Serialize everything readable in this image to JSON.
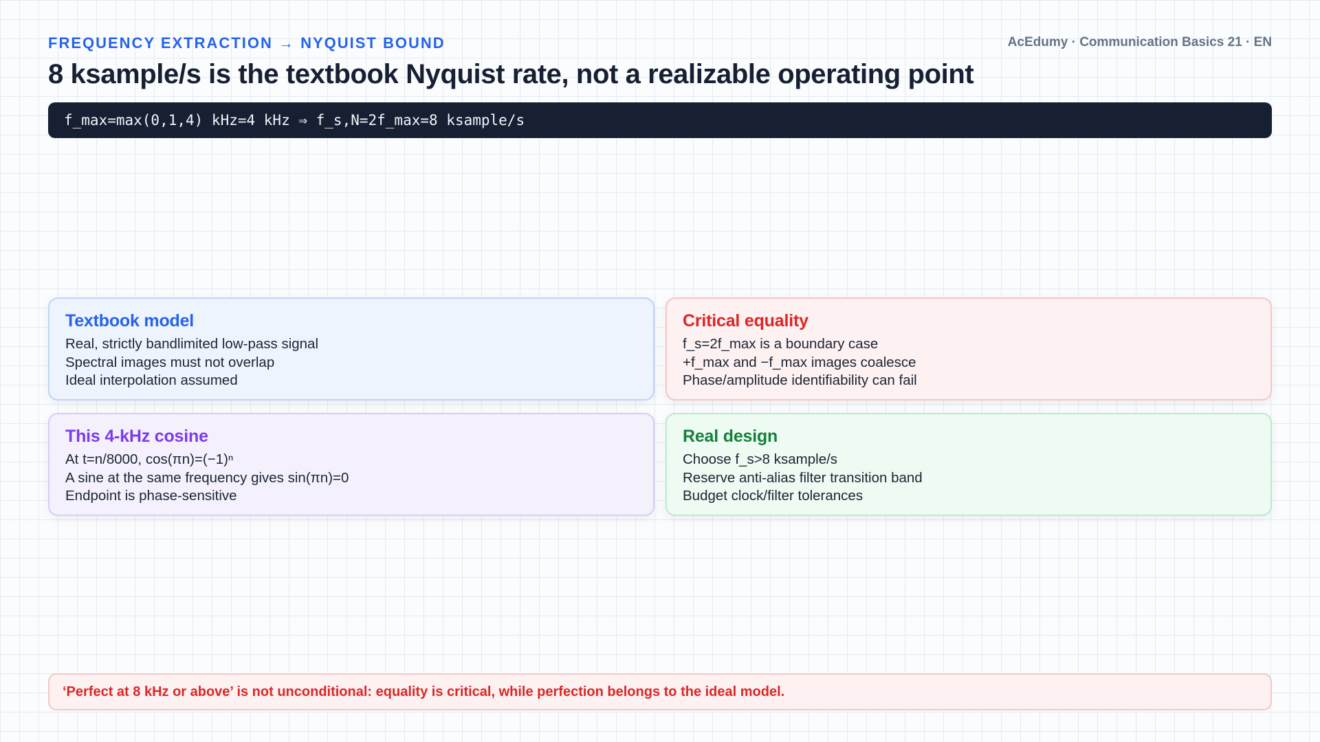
{
  "header": {
    "kicker": "FREQUENCY EXTRACTION → NYQUIST BOUND",
    "brand": "AcEdumy · Communication Basics 21 · EN",
    "title": "8 ksample/s is the textbook Nyquist rate, not a realizable operating point"
  },
  "formula": "f_max=max(0,1,4) kHz=4 kHz ⇒ f_s,N=2f_max=8 ksample/s",
  "cards": [
    {
      "title": "Textbook model",
      "lines": [
        "Real, strictly bandlimited low-pass signal",
        "Spectral images must not overlap",
        "Ideal interpolation assumed"
      ]
    },
    {
      "title": "Critical equality",
      "lines": [
        "f_s=2f_max is a boundary case",
        "+f_max and −f_max images coalesce",
        "Phase/amplitude identifiability can fail"
      ]
    },
    {
      "title": "This 4-kHz cosine",
      "lines": [
        "At t=n/8000, cos(πn)=(−1)ⁿ",
        "A sine at the same frequency gives sin(πn)=0",
        "Endpoint is phase-sensitive"
      ]
    },
    {
      "title": "Real design",
      "lines": [
        "Choose f_s>8 ksample/s",
        "Reserve anti-alias filter transition band",
        "Budget clock/filter tolerances"
      ]
    }
  ],
  "warning": "‘Perfect at 8 kHz or above’ is not unconditional: equality is critical, while perfection belongs to the ideal model.",
  "colors": {
    "blue": "#2563eb",
    "red": "#dc2626",
    "purple": "#7c3aed",
    "green": "#15803d",
    "dark": "#172033"
  }
}
